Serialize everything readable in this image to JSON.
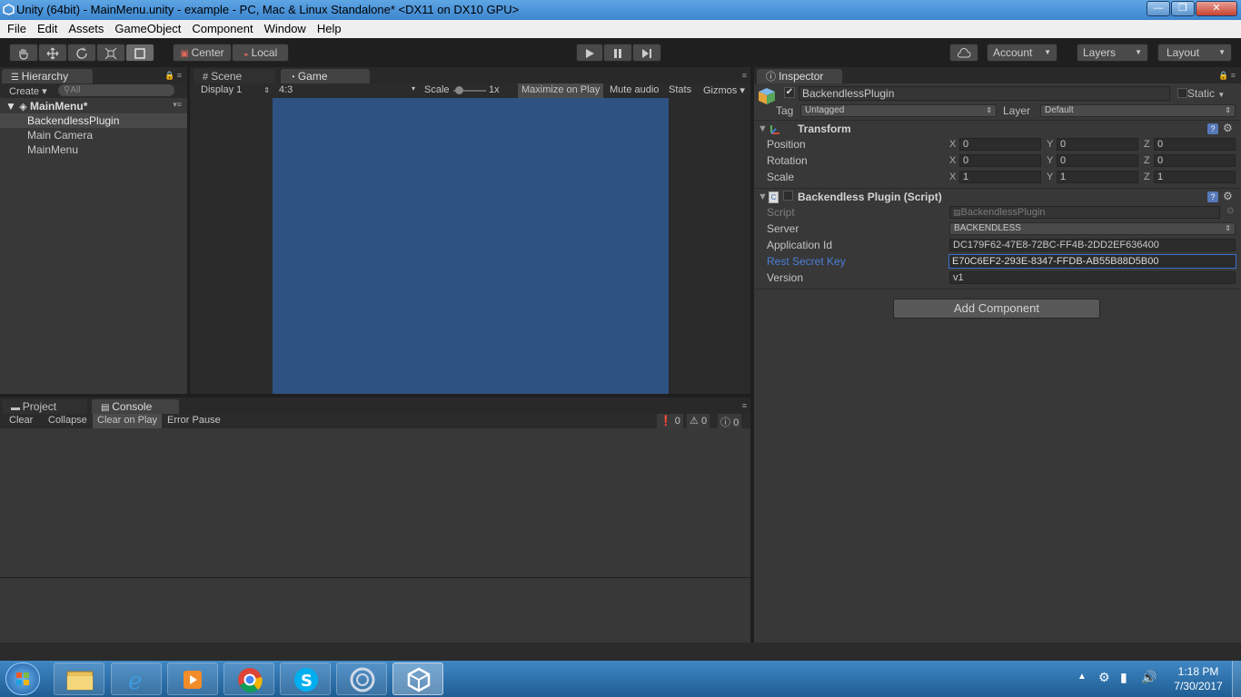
{
  "window": {
    "title": "Unity (64bit) - MainMenu.unity - example - PC, Mac & Linux Standalone* <DX11 on DX10 GPU>",
    "minimize": "—",
    "maximize": "❐",
    "close": "✕"
  },
  "menu": [
    "File",
    "Edit",
    "Assets",
    "GameObject",
    "Component",
    "Window",
    "Help"
  ],
  "toolbar": {
    "pivot": "Center",
    "space": "Local",
    "account": "Account",
    "layers": "Layers",
    "layout": "Layout"
  },
  "hierarchy": {
    "tab": "Hierarchy",
    "create": "Create",
    "search_placeholder": "All",
    "scene": "MainMenu*",
    "items": [
      "BackendlessPlugin",
      "Main Camera",
      "MainMenu"
    ]
  },
  "scene_tabs": {
    "scene": "Scene",
    "game": "Game"
  },
  "game_bar": {
    "display": "Display 1",
    "aspect": "4:3",
    "scale_label": "Scale",
    "scale_value": "1x",
    "maximize": "Maximize on Play",
    "mute": "Mute audio",
    "stats": "Stats",
    "gizmos": "Gizmos"
  },
  "game_view_color": "#2e5281",
  "bottom_tabs": {
    "project": "Project",
    "console": "Console"
  },
  "console_bar": {
    "clear": "Clear",
    "collapse": "Collapse",
    "clear_on_play": "Clear on Play",
    "error_pause": "Error Pause",
    "errors": "0",
    "warnings": "0",
    "logs": "0"
  },
  "inspector": {
    "tab": "Inspector",
    "object_name": "BackendlessPlugin",
    "static": "Static",
    "tag_label": "Tag",
    "tag": "Untagged",
    "layer_label": "Layer",
    "layer": "Default",
    "transform": {
      "title": "Transform",
      "position_label": "Position",
      "position": {
        "x": "0",
        "y": "0",
        "z": "0"
      },
      "rotation_label": "Rotation",
      "rotation": {
        "x": "0",
        "y": "0",
        "z": "0"
      },
      "scale_label": "Scale",
      "scale": {
        "x": "1",
        "y": "1",
        "z": "1"
      }
    },
    "script_component": {
      "title": "Backendless Plugin (Script)",
      "script_label": "Script",
      "script": "BackendlessPlugin",
      "server_label": "Server",
      "server": "BACKENDLESS",
      "app_id_label": "Application Id",
      "app_id": "DC179F62-47E8-72BC-FF4B-2DD2EF636400",
      "secret_label": "Rest Secret Key",
      "secret": "E70C6EF2-293E-8347-FFDB-AB55B88D5B00",
      "version_label": "Version",
      "version": "v1"
    },
    "add_component": "Add Component"
  },
  "tray": {
    "time": "1:18 PM",
    "date": "7/30/2017"
  },
  "colors": {
    "accent": "#4a7fd8",
    "selected_field": "#3d6fd0",
    "taskbar": "#2a6fae"
  }
}
